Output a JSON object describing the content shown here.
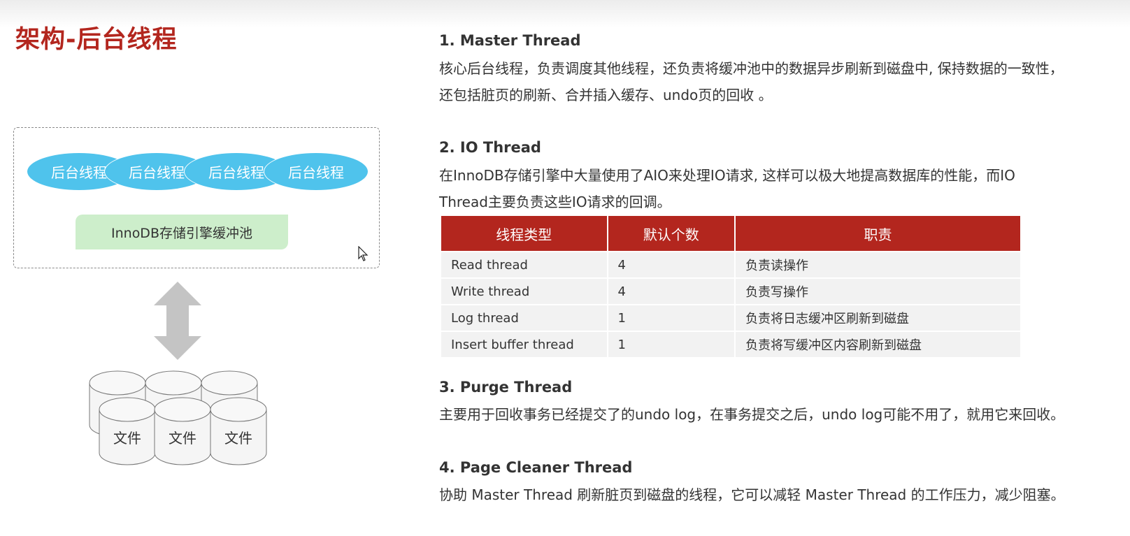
{
  "page": {
    "title": "架构-后台线程"
  },
  "diagram": {
    "threads": [
      "后台线程",
      "后台线程",
      "后台线程",
      "后台线程"
    ],
    "buffer_pool": "InnoDB存储引擎缓冲池",
    "files": [
      "文件",
      "文件",
      "文件"
    ],
    "colors": {
      "thread": "#4fc3ec",
      "buffer_pool": "#cdeecb",
      "arrow": "#c4c4c4"
    }
  },
  "sections": {
    "master": {
      "heading": "1. Master Thread",
      "line1": "核心后台线程，负责调度其他线程，还负责将缓冲池中的数据异步刷新到磁盘中, 保持数据的一致性，",
      "line2": "还包括脏页的刷新、合并插入缓存、undo页的回收 。"
    },
    "io": {
      "heading": "2. IO Thread",
      "line1": "在InnoDB存储引擎中大量使用了AIO来处理IO请求, 这样可以极大地提高数据库的性能，而IO",
      "line2": "Thread主要负责这些IO请求的回调。"
    },
    "purge": {
      "heading": "3. Purge Thread",
      "line1": "主要用于回收事务已经提交了的undo log，在事务提交之后，undo log可能不用了，就用它来回收。"
    },
    "cleaner": {
      "heading": "4. Page Cleaner Thread",
      "line1": "协助 Master Thread 刷新脏页到磁盘的线程，它可以减轻 Master Thread 的工作压力，减少阻塞。"
    }
  },
  "table": {
    "headers": [
      "线程类型",
      "默认个数",
      "职责"
    ],
    "rows": [
      [
        "Read thread",
        "4",
        "负责读操作"
      ],
      [
        "Write thread",
        "4",
        "负责写操作"
      ],
      [
        "Log thread",
        "1",
        "负责将日志缓冲区刷新到磁盘"
      ],
      [
        "Insert buffer thread",
        "1",
        "负责将写缓冲区内容刷新到磁盘"
      ]
    ],
    "header_color": "#b3261e"
  }
}
